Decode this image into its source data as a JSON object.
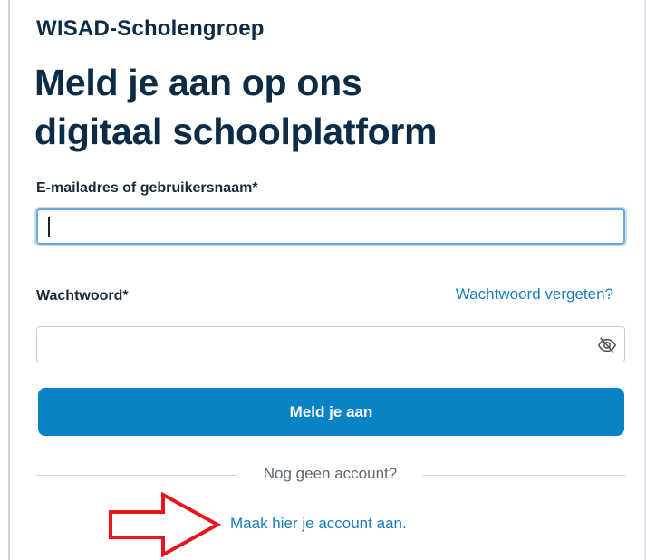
{
  "header": {
    "org_name": "WISAD-Scholengroep",
    "title_line1": "Meld je aan op ons",
    "title_line2": "digitaal schoolplatform"
  },
  "form": {
    "email_label": "E-mailadres of gebruikersnaam*",
    "email_value": "",
    "password_label": "Wachtwoord*",
    "password_value": "",
    "forgot_password": "Wachtwoord vergeten?",
    "submit_label": "Meld je aan",
    "password_toggle_icon": "eye-slash-icon"
  },
  "footer": {
    "divider_text": "Nog geen account?",
    "create_account": "Maak hier je account aan."
  },
  "annotation": {
    "arrow_icon": "red-arrow-icon",
    "arrow_color": "#e8161b"
  },
  "colors": {
    "title": "#0c2c46",
    "primary": "#0b82c6",
    "link": "#1a7dc0"
  }
}
